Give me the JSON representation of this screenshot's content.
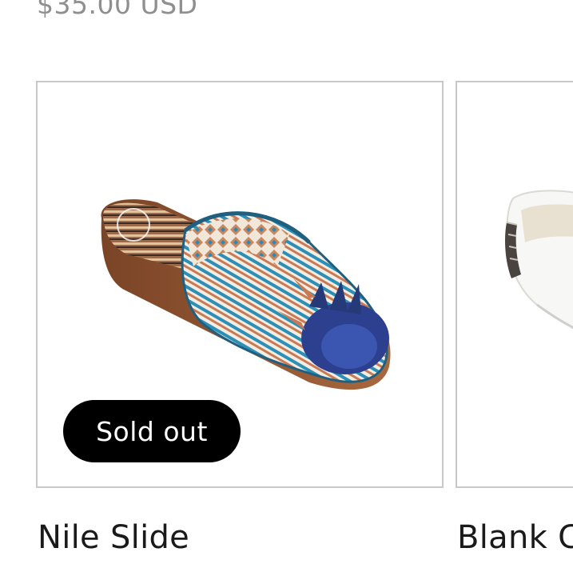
{
  "previous_product": {
    "price": "$35.00 USD"
  },
  "products": [
    {
      "title": "Nile Slide",
      "badge": "Sold out",
      "image": "patterned-mule-slide-image"
    },
    {
      "title": "Blank C",
      "image": "white-sneaker-image"
    }
  ],
  "colors": {
    "card_border": "#c8c8c8",
    "badge_bg": "#000000",
    "badge_text": "#ffffff",
    "price_text": "#8f8f8f",
    "title_text": "#1a1a1a"
  }
}
